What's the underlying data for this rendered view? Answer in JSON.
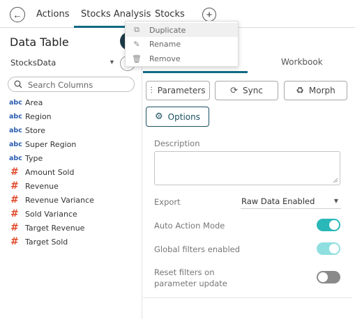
{
  "topbar": {
    "back_glyph": "←",
    "tabs": [
      {
        "label": "Actions"
      },
      {
        "label": "Stocks Analysis"
      },
      {
        "label": "Stocks"
      }
    ],
    "add_glyph": "+"
  },
  "context_menu": {
    "items": [
      {
        "label": "Duplicate",
        "icon": "duplicate-icon"
      },
      {
        "label": "Rename",
        "icon": "rename-icon"
      },
      {
        "label": "Remove",
        "icon": "trash-icon"
      }
    ]
  },
  "left_panel": {
    "title": "Data Table",
    "datasource": "StocksData",
    "search_placeholder": "Search Columns",
    "columns": [
      {
        "type": "abc",
        "name": "Area"
      },
      {
        "type": "abc",
        "name": "Region"
      },
      {
        "type": "abc",
        "name": "Store"
      },
      {
        "type": "abc",
        "name": "Super Region"
      },
      {
        "type": "abc",
        "name": "Type"
      },
      {
        "type": "#",
        "name": "Amount Sold"
      },
      {
        "type": "#",
        "name": "Revenue"
      },
      {
        "type": "#",
        "name": "Revenue Variance"
      },
      {
        "type": "#",
        "name": "Sold Variance"
      },
      {
        "type": "#",
        "name": "Target Revenue"
      },
      {
        "type": "#",
        "name": "Target Sold"
      }
    ]
  },
  "right_panel": {
    "tabs": {
      "workbook": "Workbook"
    },
    "buttons": {
      "parameters": "Parameters",
      "sync": "Sync",
      "morph": "Morph",
      "options": "Options"
    },
    "description_label": "Description",
    "export_label": "Export",
    "export_value": "Raw Data Enabled",
    "auto_action_label": "Auto Action Mode",
    "global_filters_label": "Global filters enabled",
    "reset_filters_label_1": "Reset filters on",
    "reset_filters_label_2": "parameter update",
    "toggles": {
      "auto_action_mode": true,
      "global_filters_enabled": true,
      "reset_filters_on_parameter_update": false
    }
  },
  "colors": {
    "accent": "#0f6a83",
    "toggle_on": "#2ab7b7",
    "toggle_on_light": "#8fdfe0",
    "toggle_off": "#8a8a8a",
    "abc_icon": "#2a5db0",
    "numeric_icon": "#e04a2a"
  }
}
